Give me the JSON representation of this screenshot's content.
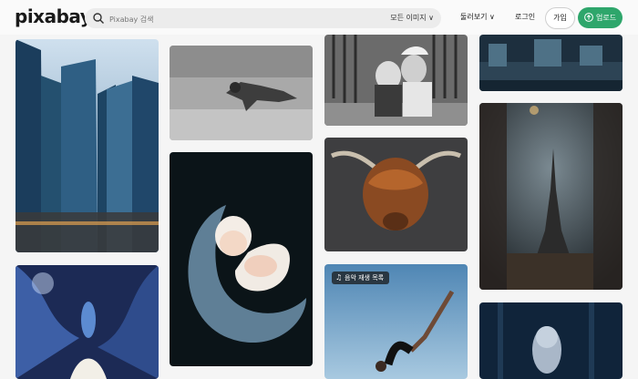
{
  "header": {
    "logo": "pixabay",
    "search": {
      "placeholder": "Pixabay 검색",
      "filter_label": "모든 이미지 ∨"
    },
    "explore_label": "둘러보기 ∨",
    "login_label": "로그인",
    "join_label": "가입",
    "upload_label": "업로드"
  },
  "gallery": {
    "badge_label": "음악 재생 목록"
  },
  "colors": {
    "accent": "#2ea66b"
  }
}
